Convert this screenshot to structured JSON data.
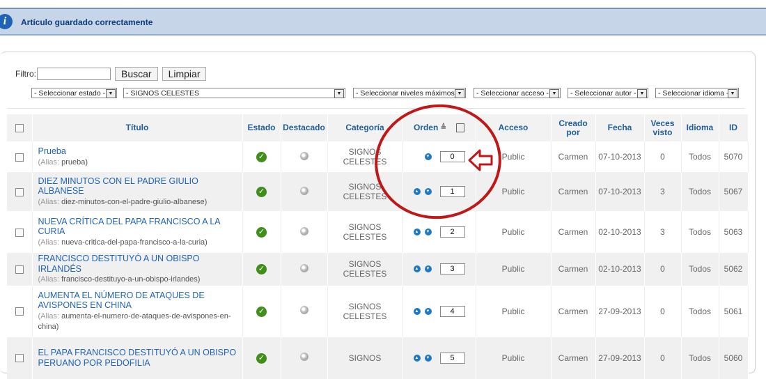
{
  "message": {
    "text": "Artículo guardado correctamente",
    "icon": "info-icon"
  },
  "filter": {
    "label": "Filtro:",
    "value": "",
    "search_label": "Buscar",
    "clear_label": "Limpiar"
  },
  "selects": {
    "state": "- Seleccionar estado -",
    "category": "- SIGNOS CELESTES",
    "levels": "- Seleccionar niveles máximos -",
    "access": "- Seleccionar acceso -",
    "author": "- Seleccionar autor -",
    "language": "- Seleccionar idioma -"
  },
  "columns": {
    "title": "Título",
    "state": "Estado",
    "featured": "Destacado",
    "category": "Categoría",
    "order": "Orden",
    "access": "Acceso",
    "created_by_1": "Creado",
    "created_by_2": "por",
    "date": "Fecha",
    "hits_1": "Veces",
    "hits_2": "visto",
    "language": "Idioma",
    "id": "ID"
  },
  "alias_label": "(Alias:",
  "rows": [
    {
      "title": "Prueba",
      "alias": "prueba)",
      "cat1": "SIGNOS",
      "cat2": "CELESTES",
      "order": "0",
      "access": "Public",
      "author": "Carmen",
      "date": "07-10-2013",
      "hits": "0",
      "language": "Todos",
      "id": "5070"
    },
    {
      "title": "DIEZ MINUTOS CON EL PADRE GIULIO ALBANESE",
      "alias": "diez-minutos-con-el-padre-giulio-albanese)",
      "cat1": "SIGNOS",
      "cat2": "CELESTES",
      "order": "1",
      "access": "Public",
      "author": "Carmen",
      "date": "07-10-2013",
      "hits": "3",
      "language": "Todos",
      "id": "5067"
    },
    {
      "title": "NUEVA CRÍTICA DEL PAPA FRANCISCO A LA CURIA",
      "alias": "nueva-critica-del-papa-francisco-a-la-curia)",
      "cat1": "SIGNOS",
      "cat2": "CELESTES",
      "order": "2",
      "access": "Public",
      "author": "Carmen",
      "date": "02-10-2013",
      "hits": "3",
      "language": "Todos",
      "id": "5063"
    },
    {
      "title": "FRANCISCO DESTITUYÓ A UN OBISPO IRLANDÉS",
      "alias": "francisco-destituyo-a-un-obispo-irlandes)",
      "cat1": "SIGNOS",
      "cat2": "CELESTES",
      "order": "3",
      "access": "Public",
      "author": "Carmen",
      "date": "02-10-2013",
      "hits": "0",
      "language": "Todos",
      "id": "5062"
    },
    {
      "title": "AUMENTA EL NÚMERO DE ATAQUES DE AVISPONES EN CHINA",
      "alias": "aumenta-el-numero-de-ataques-de-avispones-en-china)",
      "cat1": "SIGNOS",
      "cat2": "CELESTES",
      "order": "4",
      "access": "Public",
      "author": "Carmen",
      "date": "27-09-2013",
      "hits": "0",
      "language": "Todos",
      "id": "5061"
    },
    {
      "title": "EL PAPA FRANCISCO DESTITUYÓ A UN OBISPO PERUANO POR PEDOFILIA",
      "alias": "",
      "cat1": "SIGNOS",
      "cat2": "",
      "order": "5",
      "access": "Public",
      "author": "Carmen",
      "date": "27-09-2013",
      "hits": "0",
      "language": "Todos",
      "id": "5060"
    }
  ]
}
